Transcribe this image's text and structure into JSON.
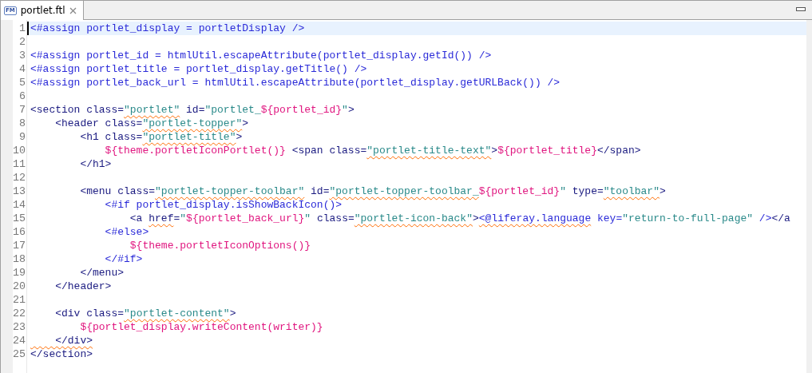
{
  "tab": {
    "title": "portlet.ftl",
    "icon": "FM",
    "selected": true
  },
  "lines": [
    {
      "number": "1",
      "current": true,
      "tokens": [
        {
          "text": "<#assign portlet_display = portletDisplay />",
          "kind": "directive",
          "flagged": false
        }
      ]
    },
    {
      "number": "2",
      "current": false
    },
    {
      "number": "3",
      "current": false,
      "tokens": [
        {
          "text": "<#assign portlet_id = htmlUtil.escapeAttribute(portlet_display.getId()) />",
          "kind": "directive",
          "flagged": false
        }
      ]
    },
    {
      "number": "4",
      "current": false,
      "tokens": [
        {
          "text": "<#assign portlet_title = portlet_display.getTitle() />",
          "kind": "directive",
          "flagged": false
        }
      ]
    },
    {
      "number": "5",
      "current": false,
      "tokens": [
        {
          "text": "<#assign portlet_back_url = htmlUtil.escapeAttribute(portlet_display.getURLBack()) />",
          "kind": "directive",
          "flagged": false
        }
      ]
    },
    {
      "number": "6",
      "current": false
    },
    {
      "number": "7",
      "current": false,
      "tokens": [
        {
          "text": "<section class=",
          "kind": "tag",
          "flagged": false
        },
        {
          "text": "\"portlet\"",
          "kind": "string",
          "flagged": true
        },
        {
          "text": " id=",
          "kind": "tag",
          "flagged": false
        },
        {
          "text": "\"portlet_",
          "kind": "string",
          "flagged": false
        },
        {
          "text": "${portlet_id}",
          "kind": "expr",
          "flagged": false
        },
        {
          "text": "\"",
          "kind": "string",
          "flagged": false
        },
        {
          "text": ">",
          "kind": "tag",
          "flagged": false
        }
      ]
    },
    {
      "number": "8",
      "current": false,
      "tokens": [
        {
          "text": "    <header class=",
          "kind": "tag",
          "flagged": false
        },
        {
          "text": "\"portlet-topper\"",
          "kind": "string",
          "flagged": true
        },
        {
          "text": ">",
          "kind": "tag",
          "flagged": false
        }
      ]
    },
    {
      "number": "9",
      "current": false,
      "tokens": [
        {
          "text": "        <h1 class=",
          "kind": "tag",
          "flagged": false
        },
        {
          "text": "\"portlet-title\"",
          "kind": "string",
          "flagged": true
        },
        {
          "text": ">",
          "kind": "tag",
          "flagged": false
        }
      ]
    },
    {
      "number": "10",
      "current": false,
      "tokens": [
        {
          "text": "            ${theme.portletIconPortlet()}",
          "kind": "expr",
          "flagged": false
        },
        {
          "text": " <span class=",
          "kind": "tag",
          "flagged": false
        },
        {
          "text": "\"portlet-title-text\"",
          "kind": "string",
          "flagged": true
        },
        {
          "text": ">",
          "kind": "tag",
          "flagged": false
        },
        {
          "text": "${portlet_title}",
          "kind": "expr",
          "flagged": false
        },
        {
          "text": "</span>",
          "kind": "tag",
          "flagged": false
        }
      ]
    },
    {
      "number": "11",
      "current": false,
      "tokens": [
        {
          "text": "        </h1>",
          "kind": "tag",
          "flagged": false
        }
      ]
    },
    {
      "number": "12",
      "current": false
    },
    {
      "number": "13",
      "current": false,
      "tokens": [
        {
          "text": "        <menu class=",
          "kind": "tag",
          "flagged": false
        },
        {
          "text": "\"portlet-topper-toolbar\"",
          "kind": "string",
          "flagged": true
        },
        {
          "text": " id=",
          "kind": "tag",
          "flagged": false
        },
        {
          "text": "\"portlet-topper-toolbar_",
          "kind": "string",
          "flagged": true
        },
        {
          "text": "${portlet_id}",
          "kind": "expr",
          "flagged": false
        },
        {
          "text": "\"",
          "kind": "string",
          "flagged": false
        },
        {
          "text": " type=",
          "kind": "tag",
          "flagged": false
        },
        {
          "text": "\"toolbar\"",
          "kind": "string",
          "flagged": true
        },
        {
          "text": ">",
          "kind": "tag",
          "flagged": false
        }
      ]
    },
    {
      "number": "14",
      "current": false,
      "tokens": [
        {
          "text": "            <#if portlet_display.isShowBackIcon()>",
          "kind": "directive",
          "flagged": false
        }
      ]
    },
    {
      "number": "15",
      "current": false,
      "tokens": [
        {
          "text": "                <a ",
          "kind": "tag",
          "flagged": false
        },
        {
          "text": "href",
          "kind": "tag",
          "flagged": true
        },
        {
          "text": "=",
          "kind": "tag",
          "flagged": false
        },
        {
          "text": "\"",
          "kind": "string",
          "flagged": false
        },
        {
          "text": "${portlet_back_url}",
          "kind": "expr",
          "flagged": false
        },
        {
          "text": "\"",
          "kind": "string",
          "flagged": false
        },
        {
          "text": " class=",
          "kind": "tag",
          "flagged": false
        },
        {
          "text": "\"portlet-icon-back\"",
          "kind": "string",
          "flagged": true
        },
        {
          "text": ">",
          "kind": "tag",
          "flagged": false
        },
        {
          "text": "<@liferay.language",
          "kind": "directive",
          "flagged": true
        },
        {
          "text": " key=",
          "kind": "directive",
          "flagged": false
        },
        {
          "text": "\"return-to-full-page\"",
          "kind": "string",
          "flagged": false
        },
        {
          "text": " />",
          "kind": "directive",
          "flagged": false
        },
        {
          "text": "</a",
          "kind": "tag",
          "flagged": false
        }
      ]
    },
    {
      "number": "16",
      "current": false,
      "tokens": [
        {
          "text": "            <#else>",
          "kind": "directive",
          "flagged": false
        }
      ]
    },
    {
      "number": "17",
      "current": false,
      "tokens": [
        {
          "text": "                ${theme.portletIconOptions()}",
          "kind": "expr",
          "flagged": false
        }
      ]
    },
    {
      "number": "18",
      "current": false,
      "tokens": [
        {
          "text": "            </#if>",
          "kind": "directive",
          "flagged": false
        }
      ]
    },
    {
      "number": "19",
      "current": false,
      "tokens": [
        {
          "text": "        </menu>",
          "kind": "tag",
          "flagged": false
        }
      ]
    },
    {
      "number": "20",
      "current": false,
      "tokens": [
        {
          "text": "    </header>",
          "kind": "tag",
          "flagged": false
        }
      ]
    },
    {
      "number": "21",
      "current": false
    },
    {
      "number": "22",
      "current": false,
      "tokens": [
        {
          "text": "    <div class=",
          "kind": "tag",
          "flagged": false
        },
        {
          "text": "\"portlet-content\"",
          "kind": "string",
          "flagged": true
        },
        {
          "text": ">",
          "kind": "tag",
          "flagged": false
        }
      ]
    },
    {
      "number": "23",
      "current": false,
      "tokens": [
        {
          "text": "        ${portlet_display.writeContent(writer)}",
          "kind": "expr",
          "flagged": false
        }
      ]
    },
    {
      "number": "24",
      "current": false,
      "tokens": [
        {
          "text": "    </div>",
          "kind": "tag",
          "flagged": true
        }
      ]
    },
    {
      "number": "25",
      "current": false,
      "tokens": [
        {
          "text": "</section>",
          "kind": "tag",
          "flagged": false
        }
      ]
    }
  ]
}
